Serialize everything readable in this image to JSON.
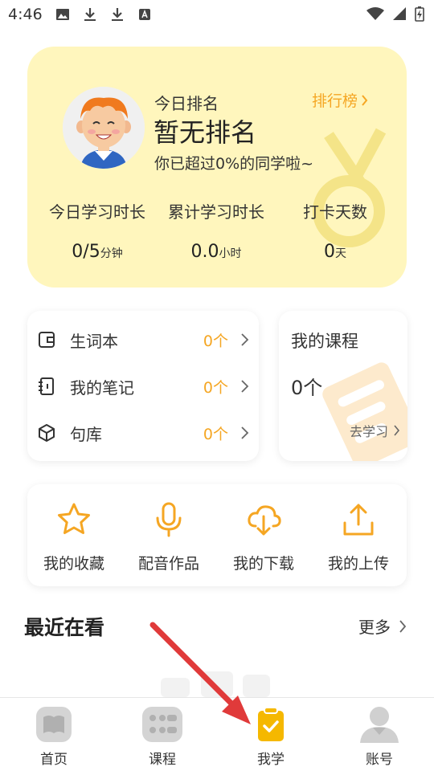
{
  "status_bar": {
    "time": "4:46",
    "left_icons": [
      "image-icon",
      "download-icon",
      "download-icon",
      "app-a-icon"
    ],
    "right_icons": [
      "wifi-icon",
      "signal-icon",
      "battery-charging-icon"
    ]
  },
  "rank_card": {
    "title": "今日排名",
    "value": "暂无排名",
    "description": "你已超过0%的同学啦~",
    "leaderboard_label": "排行榜",
    "stats": [
      {
        "label": "今日学习时长",
        "value": "0/5",
        "unit": "分钟"
      },
      {
        "label": "累计学习时长",
        "value": "0.0",
        "unit": "小时"
      },
      {
        "label": "打卡天数",
        "value": "0",
        "unit": "天"
      }
    ]
  },
  "list_card": {
    "items": [
      {
        "label": "生词本",
        "count": "0个",
        "icon": "wallet-icon"
      },
      {
        "label": "我的笔记",
        "count": "0个",
        "icon": "notebook-icon"
      },
      {
        "label": "句库",
        "count": "0个",
        "icon": "box-icon"
      }
    ]
  },
  "course_card": {
    "title": "我的课程",
    "count": "0个",
    "link_label": "去学习"
  },
  "quick_actions": [
    {
      "label": "我的收藏",
      "icon": "star-icon"
    },
    {
      "label": "配音作品",
      "icon": "microphone-icon"
    },
    {
      "label": "我的下载",
      "icon": "cloud-download-icon"
    },
    {
      "label": "我的上传",
      "icon": "upload-icon"
    }
  ],
  "recent": {
    "title": "最近在看",
    "more_label": "更多"
  },
  "bottom_nav": [
    {
      "label": "首页",
      "icon": "book-icon",
      "active": false
    },
    {
      "label": "课程",
      "icon": "grid-icon",
      "active": false
    },
    {
      "label": "我学",
      "icon": "clipboard-check-icon",
      "active": true
    },
    {
      "label": "账号",
      "icon": "user-icon",
      "active": false
    }
  ],
  "colors": {
    "accent": "#f5a623",
    "rank_card_bg": "#fff6bd",
    "nav_inactive": "#d0d0d0",
    "nav_active": "#f5b800",
    "annotation_arrow": "#e03a3a"
  }
}
